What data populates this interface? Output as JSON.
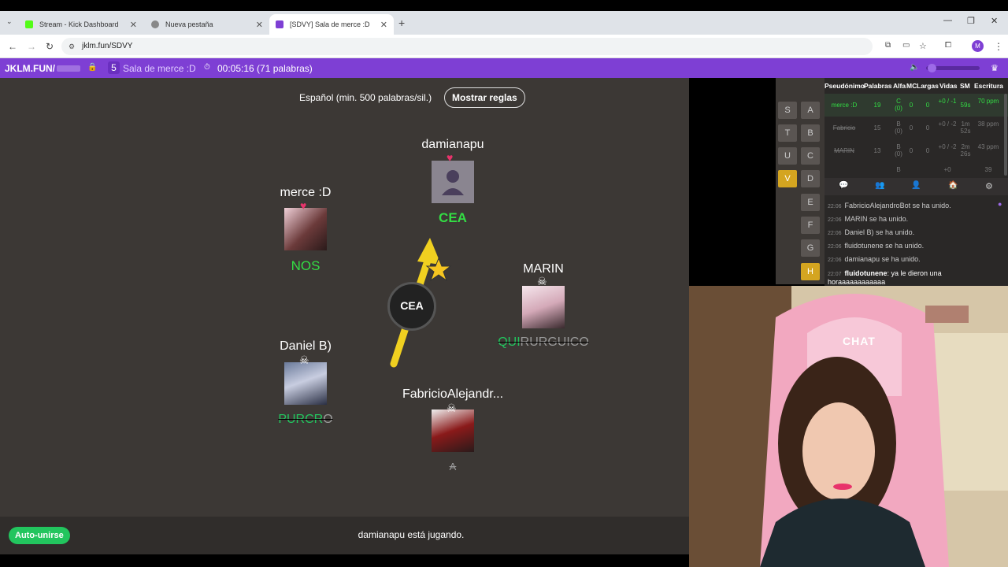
{
  "browser": {
    "tabs": [
      {
        "title": "Stream - Kick Dashboard",
        "color": "#53fc18"
      },
      {
        "title": "Nueva pestaña",
        "color": "#888888"
      },
      {
        "title": "[SDVY] Sala de merce :D",
        "color": "#7e3fd4"
      }
    ],
    "url": "jklm.fun/SDVY",
    "profile_initial": "M"
  },
  "header": {
    "site": "JKLM.FUN/",
    "player_count": "5",
    "room_name": "Sala de merce :D",
    "timer": "00:05:16 (71 palabras)"
  },
  "game": {
    "rules_text": "Español (min. 500 palabras/sil.)",
    "rules_button": "Mostrar reglas",
    "bomb_syllable": "CEA",
    "players": [
      {
        "name": "damianapu",
        "word": "CEA"
      },
      {
        "name": "merce :D",
        "word": "NOS"
      },
      {
        "name": "MARIN",
        "word_hl": "QUI",
        "word_rest": "RURGUICO"
      },
      {
        "name": "Daniel B)",
        "word_hl": "PURCR",
        "word_rest": "O"
      },
      {
        "name": "FabricioAlejandr...",
        "word": "A"
      }
    ],
    "status": "damianapu está jugando.",
    "auto_join": "Auto-unirse",
    "accent_green": "#22c55e"
  },
  "letters": {
    "left": [
      "S",
      "T",
      "U",
      "V"
    ],
    "right": [
      "A",
      "B",
      "C",
      "D",
      "E",
      "F",
      "G",
      "H"
    ],
    "active": [
      "V",
      "H"
    ]
  },
  "scoreboard": {
    "headers": [
      "Pseudónimo",
      "Palabras",
      "Alfa",
      "MC",
      "Largas",
      "Vidas",
      "SM",
      "Escritura"
    ],
    "rows": [
      {
        "name": "merce :D",
        "palabras": "19",
        "alfa": "C (0)",
        "mc": "0",
        "largas": "0",
        "vidas": "+0 / -1",
        "sm": "59s",
        "escritura": "70 ppm"
      },
      {
        "name": "Fabricio",
        "palabras": "15",
        "alfa": "B (0)",
        "mc": "0",
        "largas": "0",
        "vidas": "+0 / -2",
        "sm": "1m 52s",
        "escritura": "38 ppm"
      },
      {
        "name": "MARIN",
        "palabras": "13",
        "alfa": "B (0)",
        "mc": "0",
        "largas": "0",
        "vidas": "+0 / -2",
        "sm": "2m 26s",
        "escritura": "43 ppm"
      },
      {
        "name": "",
        "palabras": "",
        "alfa": "B",
        "mc": "",
        "largas": "",
        "vidas": "+0",
        "sm": "",
        "escritura": "39"
      }
    ]
  },
  "chat": {
    "messages": [
      {
        "time": "22:06",
        "text": "FabricioAlejandroBot se ha unido."
      },
      {
        "time": "22:06",
        "text": "MARIN se ha unido."
      },
      {
        "time": "22:06",
        "text": "Daniel B) se ha unido."
      },
      {
        "time": "22:06",
        "text": "fluidotunene se ha unido."
      },
      {
        "time": "22:06",
        "text": "damianapu se ha unido."
      },
      {
        "time": "22:07",
        "user": "fluidotunene",
        "text": ": ya le dieron una"
      },
      {
        "time": "",
        "text": "horaaaaaaaaaaaa"
      }
    ]
  },
  "webcam": {
    "sign": "CHAT"
  }
}
